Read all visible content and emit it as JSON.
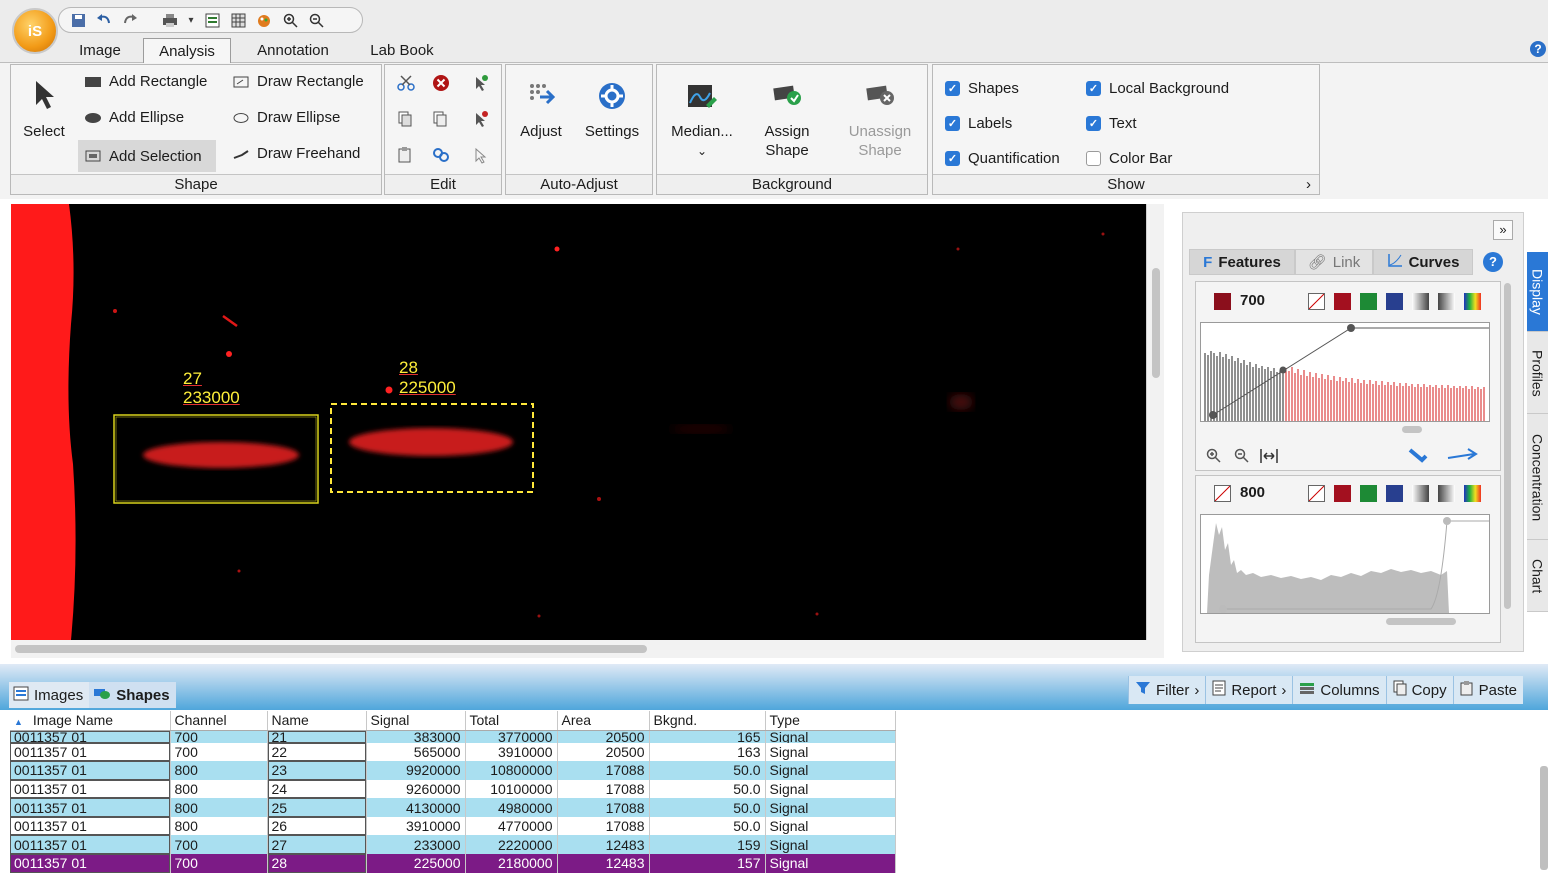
{
  "app": {
    "logo_text": "iS"
  },
  "tabs": [
    {
      "label": "Image",
      "active": false
    },
    {
      "label": "Analysis",
      "active": true
    },
    {
      "label": "Annotation",
      "active": false
    },
    {
      "label": "Lab Book",
      "active": false
    }
  ],
  "ribbon": {
    "shape": {
      "label": "Shape",
      "select": "Select",
      "add_rectangle": "Add Rectangle",
      "add_ellipse": "Add Ellipse",
      "add_selection": "Add Selection",
      "draw_rectangle": "Draw Rectangle",
      "draw_ellipse": "Draw Ellipse",
      "draw_freehand": "Draw Freehand"
    },
    "edit": {
      "label": "Edit"
    },
    "auto_adjust": {
      "label": "Auto-Adjust",
      "adjust": "Adjust",
      "settings": "Settings"
    },
    "background": {
      "label": "Background",
      "median": "Median...",
      "assign_1": "Assign",
      "assign_2": "Shape",
      "unassign_1": "Unassign",
      "unassign_2": "Shape"
    },
    "show": {
      "label": "Show",
      "shapes": "Shapes",
      "labels": "Labels",
      "quantification": "Quantification",
      "local_background": "Local Background",
      "text": "Text",
      "color_bar": "Color Bar",
      "shapes_checked": true,
      "labels_checked": true,
      "quantification_checked": true,
      "local_background_checked": true,
      "text_checked": true,
      "color_bar_checked": false
    }
  },
  "viewer": {
    "shape_27": {
      "name": "27",
      "signal": "233000"
    },
    "shape_28": {
      "name": "28",
      "signal": "225000"
    }
  },
  "panel": {
    "tabs": {
      "features": "Features",
      "link": "Link",
      "curves": "Curves"
    },
    "channel_700": "700",
    "channel_800": "800",
    "side_tabs": [
      "Display",
      "Profiles",
      "Concentration",
      "Chart"
    ]
  },
  "table_tabs": {
    "images": "Images",
    "shapes": "Shapes"
  },
  "table_tools": {
    "filter": "Filter",
    "report": "Report",
    "columns": "Columns",
    "copy": "Copy",
    "paste": "Paste"
  },
  "table": {
    "headers": [
      "Image Name",
      "Channel",
      "Name",
      "Signal",
      "Total",
      "Area",
      "Bkgnd.",
      "Type"
    ],
    "rows": [
      [
        "0011357 01",
        "700",
        "21",
        "383000",
        "3770000",
        "20500",
        "165",
        "Signal"
      ],
      [
        "0011357 01",
        "700",
        "22",
        "565000",
        "3910000",
        "20500",
        "163",
        "Signal"
      ],
      [
        "0011357 01",
        "800",
        "23",
        "9920000",
        "10800000",
        "17088",
        "50.0",
        "Signal"
      ],
      [
        "0011357 01",
        "800",
        "24",
        "9260000",
        "10100000",
        "17088",
        "50.0",
        "Signal"
      ],
      [
        "0011357 01",
        "800",
        "25",
        "4130000",
        "4980000",
        "17088",
        "50.0",
        "Signal"
      ],
      [
        "0011357 01",
        "800",
        "26",
        "3910000",
        "4770000",
        "17088",
        "50.0",
        "Signal"
      ],
      [
        "0011357 01",
        "700",
        "27",
        "233000",
        "2220000",
        "12483",
        "159",
        "Signal"
      ],
      [
        "0011357 01",
        "700",
        "28",
        "225000",
        "2180000",
        "12483",
        "157",
        "Signal"
      ]
    ]
  },
  "colors": {
    "selection_row": "#7c1b86",
    "alt_row": "#a9dff0",
    "accent": "#2a78d6",
    "shape_outline": "#ffef3a"
  }
}
